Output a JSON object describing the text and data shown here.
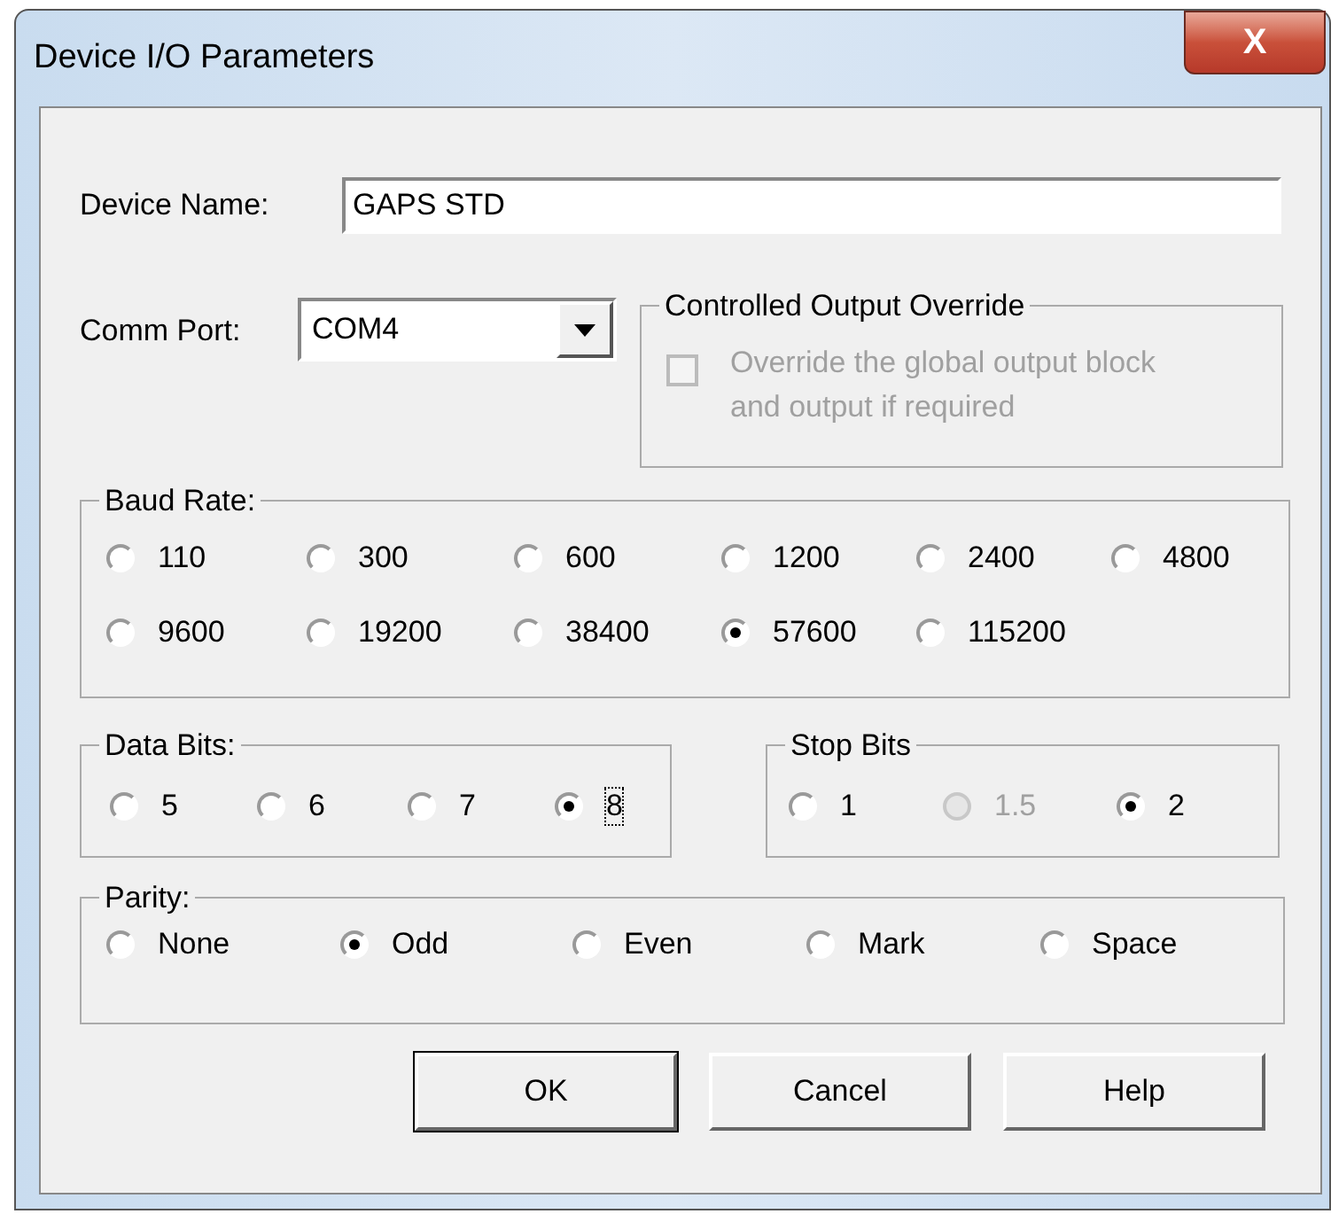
{
  "window": {
    "title": "Device I/O Parameters",
    "close_label": "X"
  },
  "device_name": {
    "label": "Device Name:",
    "value": "GAPS STD"
  },
  "comm_port": {
    "label": "Comm Port:",
    "value": "COM4"
  },
  "override": {
    "title": "Controlled Output Override",
    "label": "Override the global output block and output if required",
    "checked": false,
    "disabled": true
  },
  "baud_rate": {
    "title": "Baud Rate:",
    "options": [
      {
        "label": "110",
        "selected": false,
        "disabled": false,
        "focused": false
      },
      {
        "label": "300",
        "selected": false,
        "disabled": false,
        "focused": false
      },
      {
        "label": "600",
        "selected": false,
        "disabled": false,
        "focused": false
      },
      {
        "label": "1200",
        "selected": false,
        "disabled": false,
        "focused": false
      },
      {
        "label": "2400",
        "selected": false,
        "disabled": false,
        "focused": false
      },
      {
        "label": "4800",
        "selected": false,
        "disabled": false,
        "focused": false
      },
      {
        "label": "9600",
        "selected": false,
        "disabled": false,
        "focused": false
      },
      {
        "label": "19200",
        "selected": false,
        "disabled": false,
        "focused": false
      },
      {
        "label": "38400",
        "selected": false,
        "disabled": false,
        "focused": false
      },
      {
        "label": "57600",
        "selected": true,
        "disabled": false,
        "focused": false
      },
      {
        "label": "115200",
        "selected": false,
        "disabled": false,
        "focused": false
      }
    ]
  },
  "data_bits": {
    "title": "Data Bits:",
    "options": [
      {
        "label": "5",
        "selected": false,
        "disabled": false,
        "focused": false
      },
      {
        "label": "6",
        "selected": false,
        "disabled": false,
        "focused": false
      },
      {
        "label": "7",
        "selected": false,
        "disabled": false,
        "focused": false
      },
      {
        "label": "8",
        "selected": true,
        "disabled": false,
        "focused": true
      }
    ]
  },
  "stop_bits": {
    "title": "Stop Bits",
    "options": [
      {
        "label": "1",
        "selected": false,
        "disabled": false,
        "focused": false
      },
      {
        "label": "1.5",
        "selected": false,
        "disabled": true,
        "focused": false
      },
      {
        "label": "2",
        "selected": true,
        "disabled": false,
        "focused": false
      }
    ]
  },
  "parity": {
    "title": "Parity:",
    "options": [
      {
        "label": "None",
        "selected": false,
        "disabled": false,
        "focused": false
      },
      {
        "label": "Odd",
        "selected": true,
        "disabled": false,
        "focused": false
      },
      {
        "label": "Even",
        "selected": false,
        "disabled": false,
        "focused": false
      },
      {
        "label": "Mark",
        "selected": false,
        "disabled": false,
        "focused": false
      },
      {
        "label": "Space",
        "selected": false,
        "disabled": false,
        "focused": false
      }
    ]
  },
  "buttons": [
    "OK",
    "Cancel",
    "Help"
  ]
}
